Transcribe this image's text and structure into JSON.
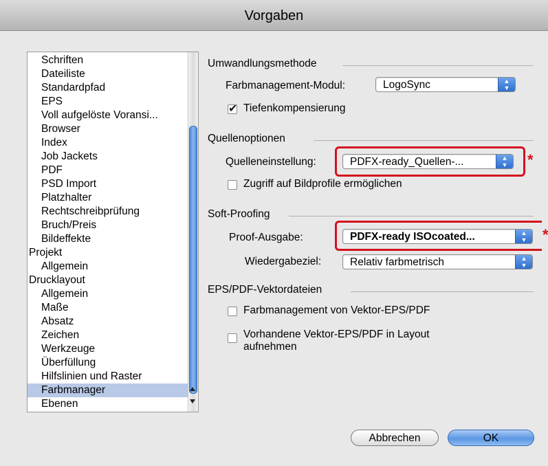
{
  "window": {
    "title": "Vorgaben"
  },
  "sidebar": {
    "items": [
      {
        "label": "Schriften",
        "level": 1
      },
      {
        "label": "Dateiliste",
        "level": 1
      },
      {
        "label": "Standardpfad",
        "level": 1
      },
      {
        "label": "EPS",
        "level": 1
      },
      {
        "label": "Voll aufgelöste Voransi...",
        "level": 1
      },
      {
        "label": "Browser",
        "level": 1
      },
      {
        "label": "Index",
        "level": 1
      },
      {
        "label": "Job Jackets",
        "level": 1
      },
      {
        "label": "PDF",
        "level": 1
      },
      {
        "label": "PSD Import",
        "level": 1
      },
      {
        "label": "Platzhalter",
        "level": 1
      },
      {
        "label": "Rechtschreibprüfung",
        "level": 1
      },
      {
        "label": "Bruch/Preis",
        "level": 1
      },
      {
        "label": "Bildeffekte",
        "level": 1
      },
      {
        "label": "Projekt",
        "level": 0
      },
      {
        "label": "Allgemein",
        "level": 1
      },
      {
        "label": "Drucklayout",
        "level": 0
      },
      {
        "label": "Allgemein",
        "level": 1
      },
      {
        "label": "Maße",
        "level": 1
      },
      {
        "label": "Absatz",
        "level": 1
      },
      {
        "label": "Zeichen",
        "level": 1
      },
      {
        "label": "Werkzeuge",
        "level": 1
      },
      {
        "label": "Überfüllung",
        "level": 1
      },
      {
        "label": "Hilfslinien und Raster",
        "level": 1
      },
      {
        "label": "Farbmanager",
        "level": 1,
        "selected": true
      },
      {
        "label": "Ebenen",
        "level": 1
      }
    ]
  },
  "umwandlung": {
    "title": "Umwandlungsmethode",
    "modul_label": "Farbmanagement-Modul:",
    "modul_value": "LogoSync",
    "tiefen_label": "Tiefenkompensierung",
    "tiefen_checked": true
  },
  "quellen": {
    "title": "Quellenoptionen",
    "einstellung_label": "Quelleneinstellung:",
    "einstellung_value": "PDFX-ready_Quellen-...",
    "zugriff_label": "Zugriff auf Bildprofile ermöglichen",
    "zugriff_checked": false
  },
  "softproof": {
    "title": "Soft-Proofing",
    "ausgabe_label": "Proof-Ausgabe:",
    "ausgabe_value": "PDFX-ready ISOcoated...",
    "wiedergabe_label": "Wiedergabeziel:",
    "wiedergabe_value": "Relativ farbmetrisch"
  },
  "eps": {
    "title": "EPS/PDF-Vektordateien",
    "farbmgmt_label": "Farbmanagement von Vektor-EPS/PDF",
    "vorhandene_label_1": "Vorhandene Vektor-EPS/PDF in Layout",
    "vorhandene_label_2": "aufnehmen"
  },
  "annotations": {
    "asterisk": "*",
    "highlight_color": "#d4121c"
  },
  "buttons": {
    "cancel": "Abbrechen",
    "ok": "OK"
  }
}
